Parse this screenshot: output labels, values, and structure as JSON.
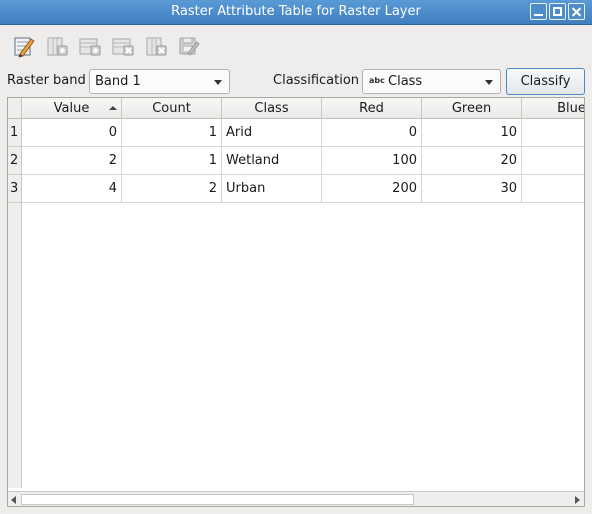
{
  "window": {
    "title": "Raster Attribute Table for Raster Layer"
  },
  "toolbar": {
    "icons": [
      "edit-pencil-icon",
      "add-column-icon",
      "add-row-icon",
      "remove-row-icon",
      "remove-column-icon",
      "save-icon"
    ]
  },
  "controls": {
    "raster_band_label": "Raster band",
    "raster_band_value": "Band 1",
    "classification_label": "Classification",
    "classification_type_icon": "abc",
    "classification_value": "Class",
    "classify_button": "Classify"
  },
  "table": {
    "columns": [
      "Value",
      "Count",
      "Class",
      "Red",
      "Green",
      "Blue"
    ],
    "sorted_column": "Value",
    "rows": [
      {
        "index": "1",
        "value": "0",
        "count": "1",
        "class": "Arid",
        "red": "0",
        "green": "10"
      },
      {
        "index": "2",
        "value": "2",
        "count": "1",
        "class": "Wetland",
        "red": "100",
        "green": "20"
      },
      {
        "index": "3",
        "value": "4",
        "count": "2",
        "class": "Urban",
        "red": "200",
        "green": "30"
      }
    ]
  },
  "colors": {
    "titlebar": "#4a8ccd",
    "accent_border": "#4a88c8"
  }
}
